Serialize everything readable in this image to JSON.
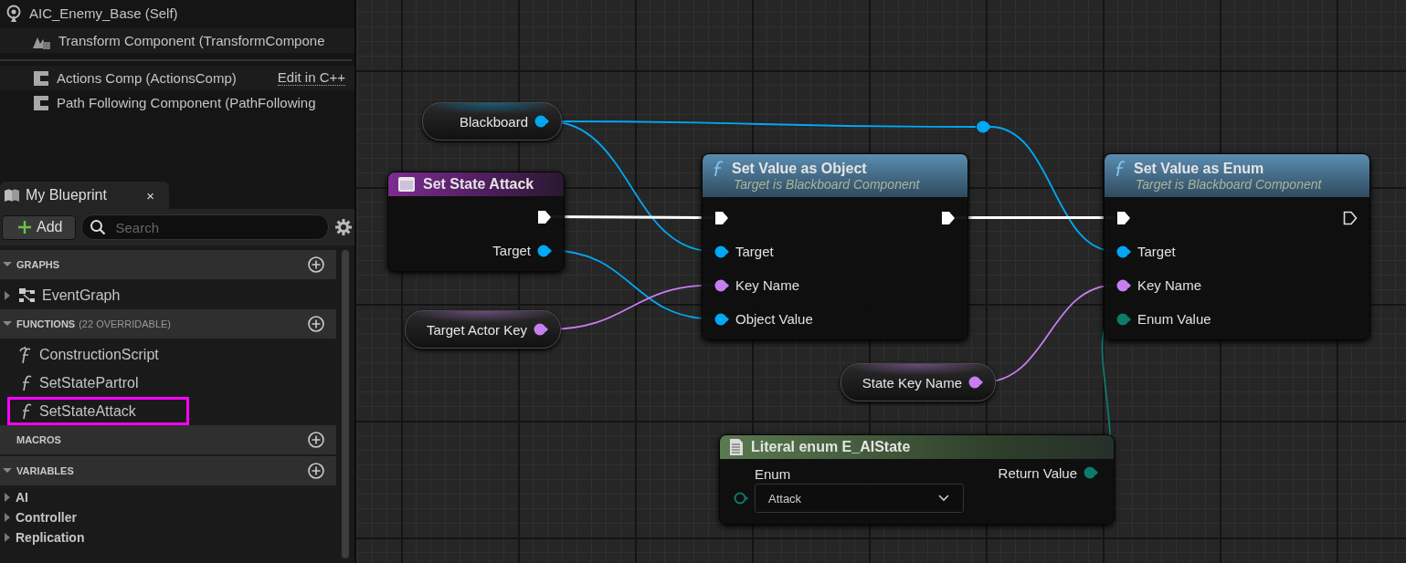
{
  "components": {
    "root": {
      "label": "AIC_Enemy_Base (Self)",
      "children": [
        {
          "label": "Transform Component (TransformCompone",
          "kind": "scene"
        }
      ]
    },
    "native": [
      {
        "label": "Actions Comp (ActionsComp)",
        "link": "Edit in C++"
      },
      {
        "label": "Path Following Component (PathFollowing"
      }
    ]
  },
  "my_blueprint": {
    "tab": {
      "label": "My Blueprint",
      "close": "×",
      "selected": true
    },
    "add_label": "Add",
    "search": {
      "placeholder": "Search"
    },
    "sections": [
      {
        "title": "GRAPHS",
        "expanded": true,
        "items": [
          {
            "label": "EventGraph",
            "kind": "graph",
            "expanded": false
          }
        ]
      },
      {
        "title": "FUNCTIONS",
        "note": "(22 OVERRIDABLE)",
        "expanded": true,
        "items": [
          {
            "label": "ConstructionScript",
            "kind": "construction",
            "highlighted": false
          },
          {
            "label": "SetStatePartrol",
            "kind": "function",
            "highlighted": false
          },
          {
            "label": "SetStateAttack",
            "kind": "function",
            "highlighted": true
          }
        ]
      },
      {
        "title": "MACROS",
        "expanded": false
      },
      {
        "title": "VARIABLES",
        "expanded": true,
        "items": [
          {
            "label": "AI",
            "kind": "category",
            "expanded": false
          },
          {
            "label": "Controller",
            "kind": "category",
            "expanded": false
          },
          {
            "label": "Replication",
            "kind": "category",
            "expanded": false
          }
        ]
      }
    ]
  },
  "graph": {
    "nodes": [
      {
        "kind": "variable",
        "outputs": [
          {
            "label": "Blackboard",
            "kind": "object",
            "connected": true
          }
        ]
      },
      {
        "kind": "entry",
        "title": "Set State Attack",
        "outputs": [
          {
            "kind": "exec",
            "connected": true
          },
          {
            "label": "Target",
            "kind": "object",
            "connected": true
          }
        ]
      },
      {
        "kind": "function",
        "title": "Set Value as Object",
        "subtitle": "Target is Blackboard Component",
        "inputs": [
          {
            "kind": "exec",
            "connected": true
          },
          {
            "label": "Target",
            "kind": "object",
            "connected": true
          },
          {
            "label": "Key Name",
            "kind": "name",
            "connected": true
          },
          {
            "label": "Object Value",
            "kind": "object",
            "connected": true
          }
        ],
        "outputs": [
          {
            "kind": "exec",
            "connected": true
          }
        ]
      },
      {
        "kind": "variable",
        "outputs": [
          {
            "label": "Target Actor Key",
            "kind": "name",
            "connected": true
          }
        ]
      },
      {
        "kind": "function",
        "title": "Set Value as Enum",
        "subtitle": "Target is Blackboard Component",
        "inputs": [
          {
            "kind": "exec",
            "connected": true
          },
          {
            "label": "Target",
            "kind": "object",
            "connected": true
          },
          {
            "label": "Key Name",
            "kind": "name",
            "connected": true
          },
          {
            "label": "Enum Value",
            "kind": "enum",
            "connected": true
          }
        ],
        "outputs": [
          {
            "kind": "exec",
            "connected": false
          }
        ]
      },
      {
        "kind": "variable",
        "outputs": [
          {
            "label": "State Key Name",
            "kind": "name",
            "connected": true
          }
        ]
      },
      {
        "kind": "literal",
        "title": "Literal enum E_AIState",
        "inputs": [
          {
            "label": "Enum",
            "kind": "enum",
            "connected": false,
            "value": "Attack"
          }
        ],
        "outputs": [
          {
            "label": "Return Value",
            "kind": "enum",
            "connected": true
          }
        ]
      }
    ]
  }
}
